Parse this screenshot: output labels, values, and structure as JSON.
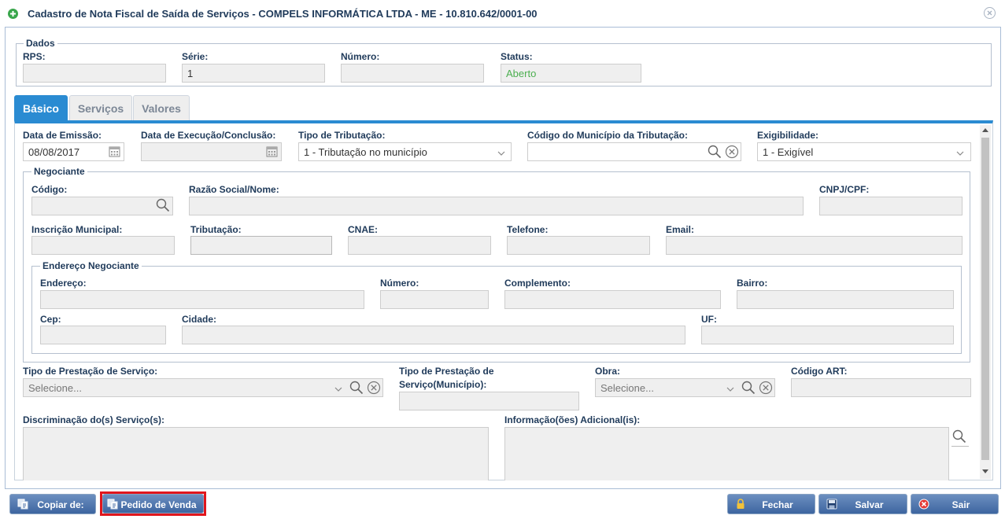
{
  "window": {
    "title": "Cadastro de Nota Fiscal de Saída de Serviços - COMPELS INFORMÁTICA LTDA - ME - 10.810.642/0001-00"
  },
  "dados": {
    "legend": "Dados",
    "rps_label": "RPS:",
    "rps_value": "",
    "serie_label": "Série:",
    "serie_value": "1",
    "numero_label": "Número:",
    "numero_value": "",
    "status_label": "Status:",
    "status_value": "Aberto",
    "status_color": "#4caf50"
  },
  "tabs": [
    {
      "label": "Básico",
      "active": true
    },
    {
      "label": "Serviços",
      "active": false
    },
    {
      "label": "Valores",
      "active": false
    }
  ],
  "basico": {
    "data_emissao_label": "Data de Emissão:",
    "data_emissao_value": "08/08/2017",
    "data_execucao_label": "Data de Execução/Conclusão:",
    "data_execucao_value": "",
    "tipo_tributacao_label": "Tipo de Tributação:",
    "tipo_tributacao_value": "1 - Tributação no município",
    "codigo_municipio_label": "Código do Município da Tributação:",
    "codigo_municipio_value": "",
    "exigibilidade_label": "Exigibilidade:",
    "exigibilidade_value": "1 - Exigível"
  },
  "negociante": {
    "legend": "Negociante",
    "codigo_label": "Código:",
    "razao_label": "Razão Social/Nome:",
    "cnpj_label": "CNPJ/CPF:",
    "inscricao_label": "Inscrição Municipal:",
    "tributacao_label": "Tributação:",
    "cnae_label": "CNAE:",
    "telefone_label": "Telefone:",
    "email_label": "Email:"
  },
  "endereco": {
    "legend": "Endereço Negociante",
    "endereco_label": "Endereço:",
    "numero_label": "Número:",
    "complemento_label": "Complemento:",
    "bairro_label": "Bairro:",
    "cep_label": "Cep:",
    "cidade_label": "Cidade:",
    "uf_label": "UF:"
  },
  "servico": {
    "tipo_prestacao_label": "Tipo de Prestação de Serviço:",
    "tipo_prestacao_placeholder": "Selecione...",
    "tipo_prestacao_mun_label_1": "Tipo de Prestação de",
    "tipo_prestacao_mun_label_2": "Serviço(Município):",
    "obra_label": "Obra:",
    "obra_placeholder": "Selecione...",
    "codigo_art_label": "Código ART:",
    "discriminacao_label": "Discriminação do(s) Serviço(s):",
    "informacao_label": "Informação(ões) Adicional(is):"
  },
  "footer": {
    "copiar_label": "Copiar de:",
    "pedido_label": "Pedido de Venda",
    "fechar_label": "Fechar",
    "salvar_label": "Salvar",
    "sair_label": "Sair",
    "highlight_color": "#e0161d"
  },
  "colors": {
    "accent": "#2a8bd2",
    "label": "#1f3a5a",
    "button": "#4a70a8"
  }
}
